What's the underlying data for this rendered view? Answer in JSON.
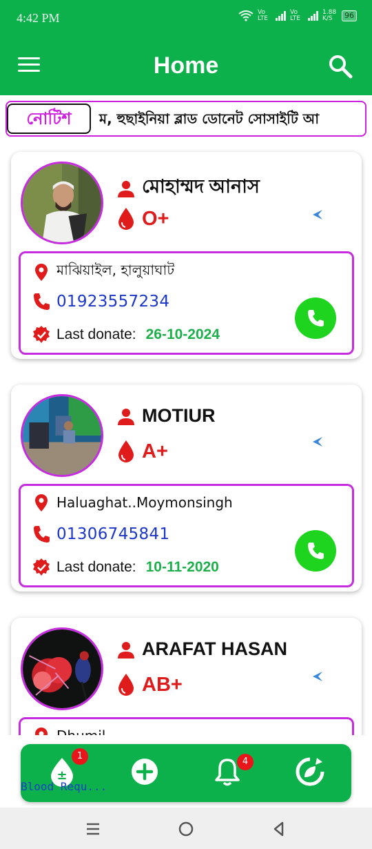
{
  "status_bar": {
    "time": "4:42 PM",
    "network_speed": "1.88\nK/S",
    "battery": "96",
    "lte1": "Vo LTE",
    "lte2": "Vo LTE"
  },
  "app_bar": {
    "title": "Home",
    "menu_icon": "hamburger-menu-icon",
    "search_icon": "search-icon"
  },
  "notice": {
    "label": "নোটিশ",
    "text": "ম, হুছাইনিয়া ব্লাড ডোনেট সোসাইটি আ"
  },
  "donors": [
    {
      "name": "মোহাম্মদ আনাস",
      "blood_group": "O+",
      "location": "মাঝিয়াইল, হালুয়াঘাট",
      "phone": "01923557234",
      "last_donate_label": "Last donate:",
      "last_donate_date": "26-10-2024"
    },
    {
      "name": "MOTIUR",
      "blood_group": "A+",
      "location": "Haluaghat..Moymonsingh",
      "phone": "01306745841",
      "last_donate_label": "Last donate:",
      "last_donate_date": "10-11-2020"
    },
    {
      "name": "ARAFAT HASAN",
      "blood_group": "AB+",
      "location": "Dhumil...",
      "phone": "",
      "last_donate_label": "",
      "last_donate_date": ""
    }
  ],
  "bottom_nav": {
    "items": [
      {
        "icon": "blood-request-icon",
        "label": "Blood Requ...",
        "badge": "1"
      },
      {
        "icon": "add-icon",
        "label": "",
        "badge": ""
      },
      {
        "icon": "notification-bell-icon",
        "label": "",
        "badge": "4"
      },
      {
        "icon": "refresh-leaf-icon",
        "label": "",
        "badge": ""
      }
    ]
  },
  "colors": {
    "primary": "#0db14b",
    "accent": "#c72be0",
    "blood": "#e01b1b",
    "phone": "#1b36c8",
    "date": "#1db04a",
    "call": "#1fd41f"
  }
}
